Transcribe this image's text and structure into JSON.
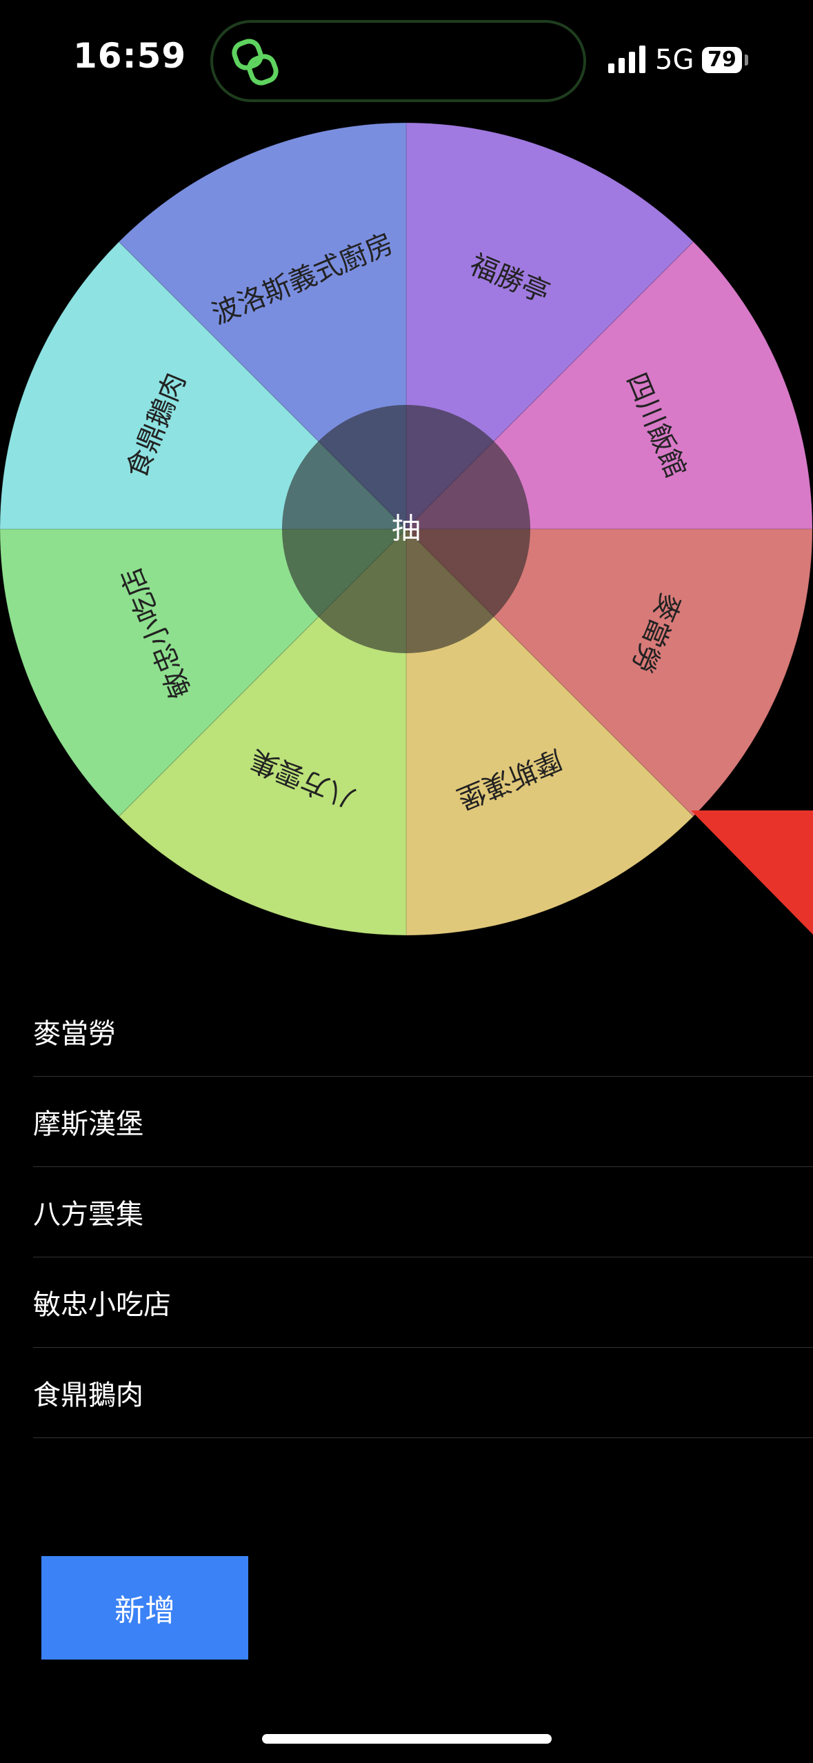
{
  "status_bar": {
    "time": "16:59",
    "network": "5G",
    "battery": "79"
  },
  "wheel": {
    "center_label": "抽",
    "segments": [
      {
        "label": "福勝亭",
        "color": "#a07ae0"
      },
      {
        "label": "四川飯館",
        "color": "#d87ac8"
      },
      {
        "label": "麥當勞",
        "color": "#d87a78"
      },
      {
        "label": "摩斯漢堡",
        "color": "#e0c87a"
      },
      {
        "label": "八方雲集",
        "color": "#bce27a"
      },
      {
        "label": "敏忠小吃店",
        "color": "#8ee08e"
      },
      {
        "label": "食鼎鵝肉",
        "color": "#8ee2e2"
      },
      {
        "label": "波洛斯義式廚房",
        "color": "#7a8ee0"
      }
    ],
    "pointer_color": "#e8332a"
  },
  "list": {
    "items": [
      "麥當勞",
      "摩斯漢堡",
      "八方雲集",
      "敏忠小吃店",
      "食鼎鵝肉"
    ]
  },
  "add_button": {
    "label": "新增",
    "color": "#3b82f6"
  }
}
